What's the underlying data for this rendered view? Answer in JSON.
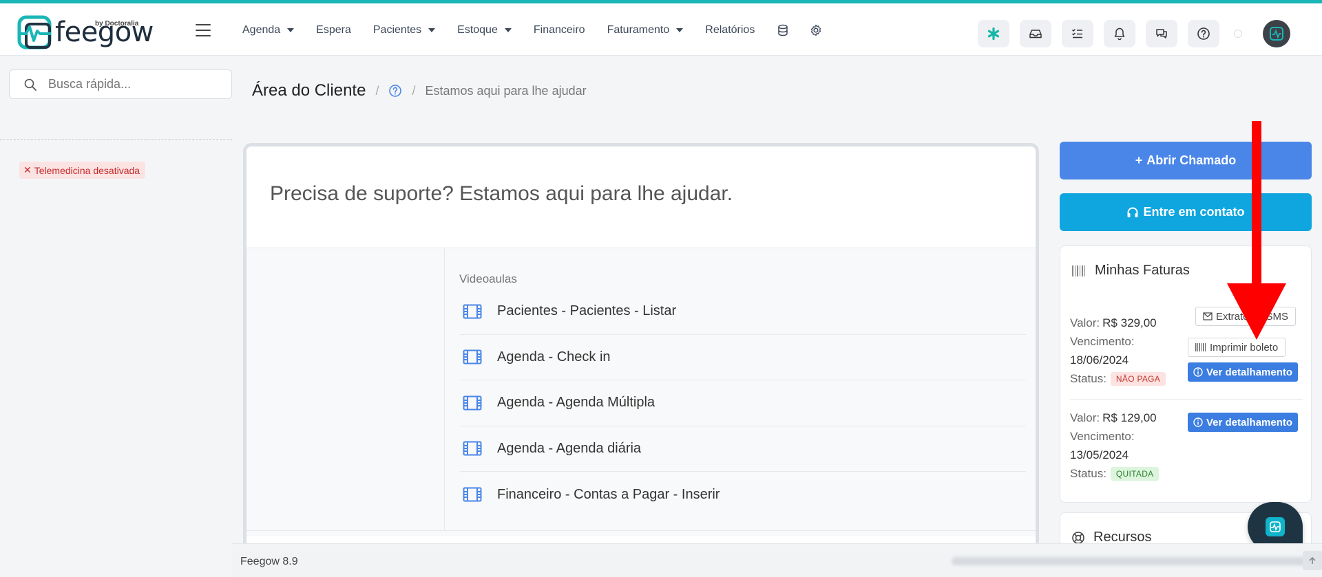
{
  "app": {
    "logo_text": "feegow",
    "logo_by": "by Doctoralia"
  },
  "nav": {
    "items": [
      {
        "label": "Agenda",
        "dropdown": true
      },
      {
        "label": "Espera",
        "dropdown": false
      },
      {
        "label": "Pacientes",
        "dropdown": true
      },
      {
        "label": "Estoque",
        "dropdown": true
      },
      {
        "label": "Financeiro",
        "dropdown": false
      },
      {
        "label": "Faturamento",
        "dropdown": true
      },
      {
        "label": "Relatórios",
        "dropdown": false
      }
    ],
    "icons": [
      "database-icon",
      "gear-icon"
    ],
    "right_icons": [
      "asterisk-icon",
      "inbox-icon",
      "checklist-icon",
      "bell-icon",
      "chat-icon",
      "help-icon"
    ]
  },
  "sidebar": {
    "search_placeholder": "Busca rápida...",
    "telemedicine_badge": "Telemedicina desativada"
  },
  "breadcrumb": {
    "title": "Área do Cliente",
    "subtitle": "Estamos aqui para lhe ajudar"
  },
  "main": {
    "headline": "Precisa de suporte? Estamos aqui para lhe ajudar.",
    "videos_title": "Videoaulas",
    "videos": [
      "Pacientes - Pacientes - Listar",
      "Agenda - Check in",
      "Agenda - Agenda Múltipla",
      "Agenda - Agenda diária",
      "Financeiro - Contas a Pagar - Inserir"
    ]
  },
  "actions": {
    "open_ticket": "Abrir Chamado",
    "contact": "Entre em contato"
  },
  "invoices": {
    "title": "Minhas Faturas",
    "value_label": "Valor:",
    "due_label": "Vencimento:",
    "status_label": "Status:",
    "extract_label": "Extrato",
    "sms_label": "SMS",
    "print_label": "Imprimir boleto",
    "details_label": "Ver detalhamento",
    "items": [
      {
        "value": "R$ 329,00",
        "due": "18/06/2024",
        "status": "NÃO PAGA",
        "status_color": "#c0392b"
      },
      {
        "value": "R$ 129,00",
        "due": "13/05/2024",
        "status": "QUITADA",
        "status_color": "#2e7d32"
      }
    ]
  },
  "resources": {
    "title": "Recursos"
  },
  "footer": {
    "version": "Feegow 8.9"
  },
  "colors": {
    "primary": "#4a86e8",
    "info": "#0fa6e0",
    "accent_teal": "#1ab6b6",
    "annotation_arrow": "#ff0000"
  }
}
